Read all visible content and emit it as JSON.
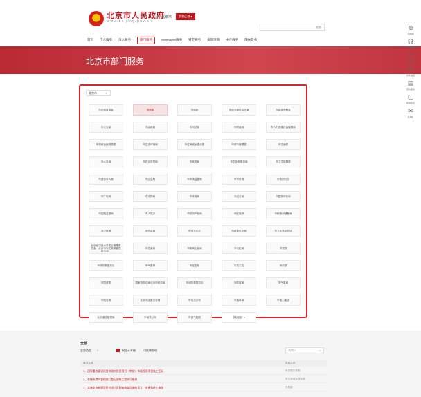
{
  "header": {
    "site_title": "北京市人民政府",
    "site_url": "www.beijing.gov.cn",
    "location_label": "当前",
    "location_value": "北京市",
    "location_button": "切换区域 ▾",
    "search_button": "搜索"
  },
  "nav": [
    {
      "label": "首页"
    },
    {
      "label": "个人服务"
    },
    {
      "label": "法人服务"
    },
    {
      "label": "部门服务"
    },
    {
      "label": "everyone服务"
    },
    {
      "label": "特定服务"
    },
    {
      "label": "投资项目"
    },
    {
      "label": "中介服务"
    },
    {
      "label": "阳光政务"
    }
  ],
  "banner": {
    "title": "北京市部门服务"
  },
  "sidebar": [
    {
      "icon": "person-icon",
      "glyph": "⊕",
      "label": "无障碍"
    },
    {
      "icon": "headset-icon",
      "glyph": "☊",
      "label": "智能客服"
    },
    {
      "icon": "monitor-icon",
      "glyph": "▭",
      "label": "网上服务"
    },
    {
      "icon": "refresh-icon",
      "glyph": "↻",
      "label": "办件进度"
    },
    {
      "icon": "calendar-icon",
      "glyph": "▤",
      "label": "预约服务"
    },
    {
      "icon": "doc-icon",
      "glyph": "▢",
      "label": "投诉建议"
    },
    {
      "icon": "chat-icon",
      "glyph": "✉",
      "label": "互动区"
    }
  ],
  "filter": {
    "value": "北京市",
    "caret": "∨"
  },
  "departments": [
    "市发展改革委",
    "市教委",
    "市科委",
    "市经济和信息化局",
    "市民族宗教委",
    "市公安局",
    "市民政局",
    "市司法局",
    "市财政局",
    "市人力资源社会保障局",
    "市规划自然资源委",
    "市生态环境局",
    "市住房城乡建设委",
    "市城市管理委",
    "市交通委",
    "市水务局",
    "市农业农村局",
    "市商务局",
    "市文化和旅游局",
    "市卫生健康委",
    "市退役军人局",
    "市应急局",
    "市市场监管局",
    "市审计局",
    "市政府外办",
    "市广电局",
    "市文物局",
    "市体育局",
    "市统计局",
    "市园林绿化局",
    "市金融监管局",
    "市人防办",
    "市知识产权局",
    "市医保局",
    "市粮食和储备局",
    "市中医局",
    "市药监局",
    "市地方志办",
    "市城管执法局",
    "市文化执法总队",
    "北京经济技术开发区管理委员会（北京市亦庄新城管理委员会）",
    "市档案局",
    "市新闻出版局",
    "市电影局",
    "市残联",
    "市消防救援总队",
    "市气象局",
    "市保密局",
    "市总工会",
    "市妇联",
    "市国资委",
    "国家税务总局北京市税务局",
    "市消防救援总队",
    "市邮政局",
    "市气象局",
    "市税务局",
    "北京市国家安全局",
    "市电力公司",
    "市烟草局",
    "市电力集团",
    "北京通信管理局",
    "市地铁公司",
    "市燃气集团",
    "收起全部 ∧"
  ],
  "lower": {
    "title": "全部",
    "type_label": "全部类型",
    "type_caret": "∨",
    "check_label": "仅显示本级",
    "handle_label": "可在线办理",
    "search_placeholder": "请输入",
    "search_icon": "○",
    "col_name": "事项名称",
    "col_dept": "实施主体",
    "rows": [
      {
        "name": "1、国家重点建设项目和政府投资项目（审批）市级投资项目施工招标",
        "dept": "市发展改革委"
      },
      {
        "name": "2、在城市房产管理部门登记建筑工程许可备案",
        "dept": "市住房城乡建设委"
      },
      {
        "name": "3、实施本市新建居民住宅小区配套教育设施的设立、变更和终止审批",
        "dept": "市教委"
      }
    ]
  },
  "colors": {
    "accent": "#c0161e",
    "banner": "#c1343d",
    "highlight": "#e0242a"
  }
}
